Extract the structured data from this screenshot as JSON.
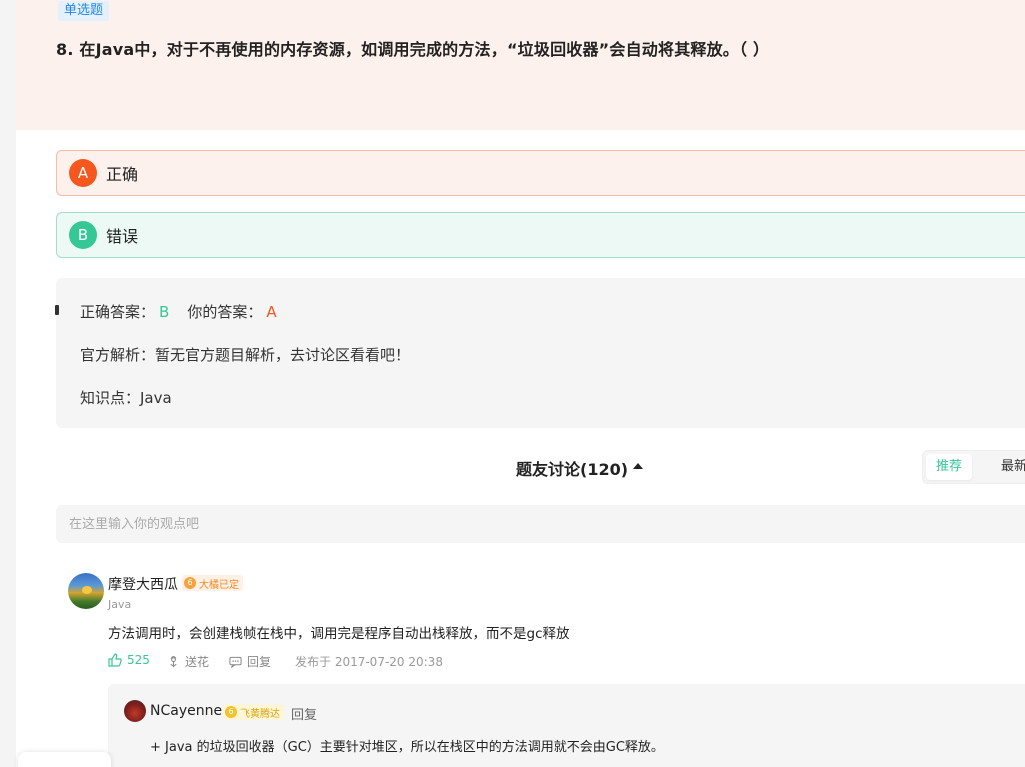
{
  "question": {
    "type_tag": "单选题",
    "text": "8. 在Java中，对于不再使用的内存资源，如调用完成的方法，“垃圾回收器”会自动将其释放。（ ）"
  },
  "options": [
    {
      "letter": "A",
      "text": "正确",
      "state": "wrong"
    },
    {
      "letter": "B",
      "text": "错误",
      "state": "correct"
    }
  ],
  "answer": {
    "correct_label": "正确答案：",
    "correct_value": "B",
    "your_label": "你的答案：",
    "your_value": "A",
    "analysis": "官方解析：暂无官方题目解析，去讨论区看看吧！",
    "knowledge": "知识点：Java"
  },
  "discussion": {
    "title": "题友讨论(120)",
    "sort_tabs": [
      "推荐",
      "最新"
    ],
    "input_placeholder": "在这里输入你的观点吧"
  },
  "comment": {
    "user": "摩登大西瓜",
    "badge": "大橘已定",
    "tag": "Java",
    "text": "方法调用时，会创建栈帧在栈中，调用完是程序自动出栈释放，而不是gc释放",
    "likes": "525",
    "flower": "送花",
    "reply": "回复",
    "date": "发布于 2017-07-20 20:38"
  },
  "reply": {
    "user": "NCayenne",
    "badge": "飞黄腾达",
    "reply_label": "回复",
    "text": "+ Java 的垃圾回收器（GC）主要针对堆区，所以在栈区中的方法调用就不会由GC释放。"
  },
  "colors": {
    "wrong": "#f5571e",
    "correct": "#36c796",
    "header_bg": "#fdf1ed",
    "tag_blue": "#2389e6"
  }
}
